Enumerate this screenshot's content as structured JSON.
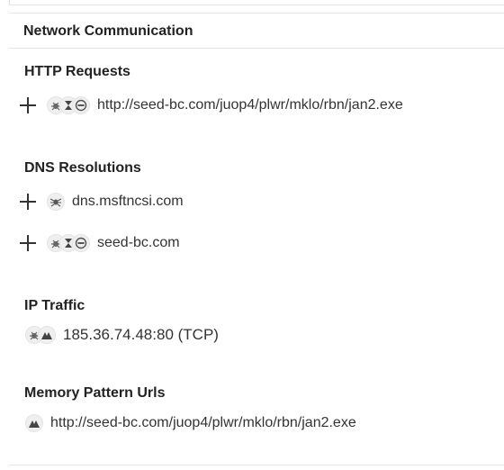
{
  "section": {
    "title": "Network Communication"
  },
  "http": {
    "title": "HTTP Requests",
    "items": [
      {
        "url": "http://seed-bc.com/juop4/plwr/mklo/rbn/jan2.exe"
      }
    ]
  },
  "dns": {
    "title": "DNS Resolutions",
    "items": [
      {
        "host": "dns.msftncsi.com"
      },
      {
        "host": "seed-bc.com"
      }
    ]
  },
  "ip": {
    "title": "IP Traffic",
    "items": [
      {
        "value": "185.36.74.48:80 (TCP)"
      }
    ]
  },
  "mem": {
    "title": "Memory Pattern Urls",
    "items": [
      {
        "url": "http://seed-bc.com/juop4/plwr/mklo/rbn/jan2.exe"
      }
    ]
  },
  "icons": {
    "expand": "plus-icon",
    "engines": [
      "bug-engine-icon",
      "hourglass-engine-icon",
      "badge-engine-icon",
      "mountain-engine-icon",
      "spider-engine-icon"
    ]
  }
}
